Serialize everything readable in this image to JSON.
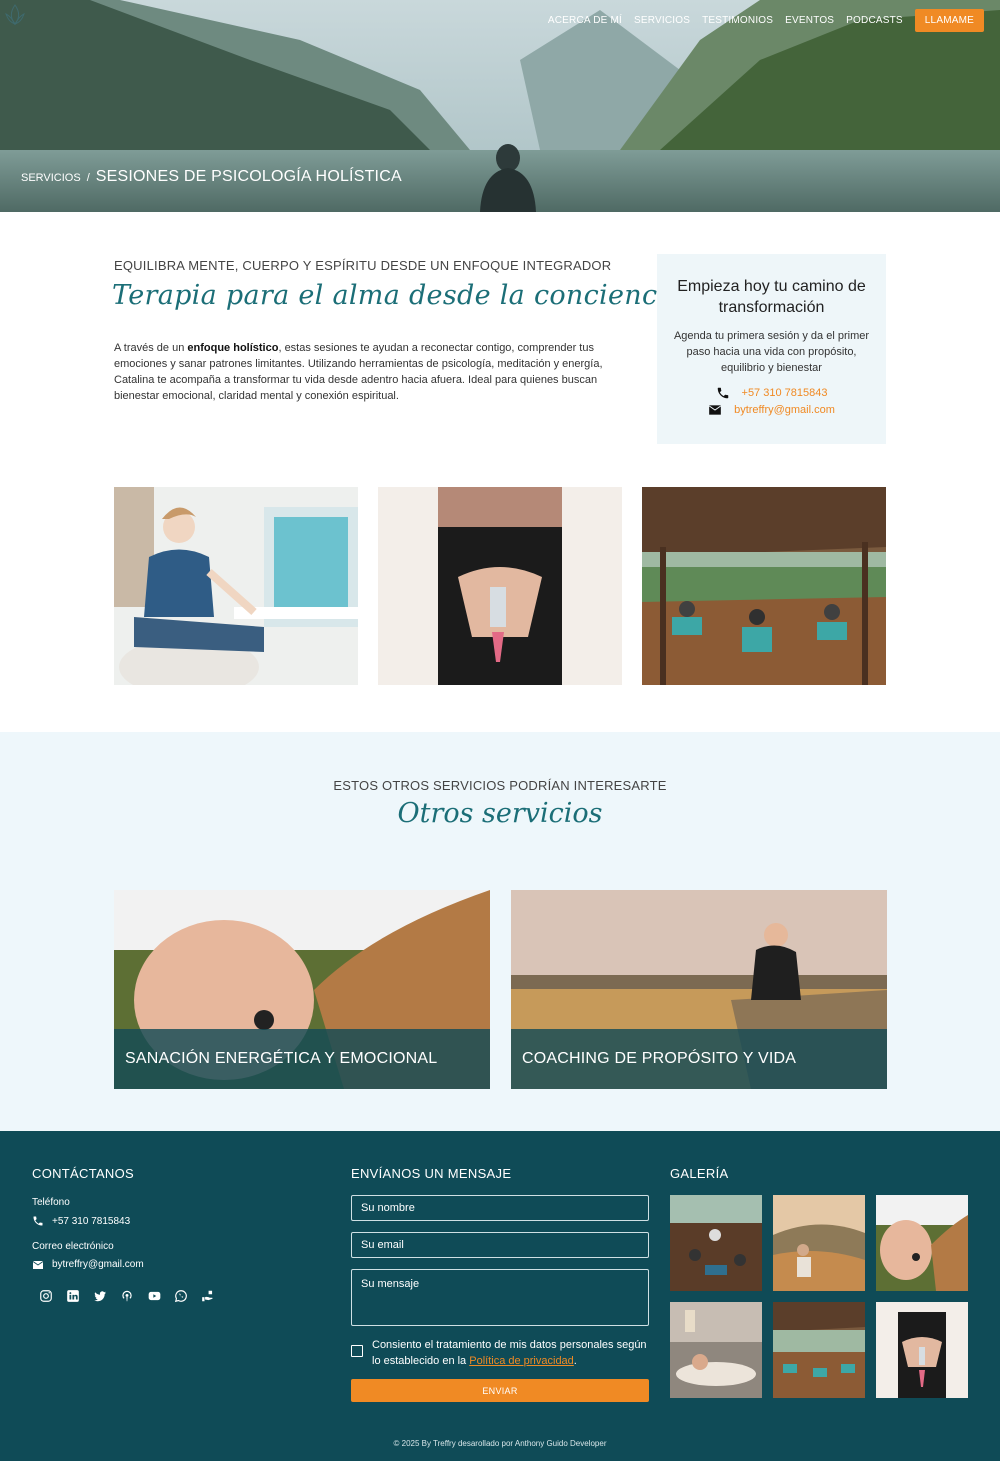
{
  "nav": {
    "items": [
      "ACERCA DE MÍ",
      "SERVICIOS",
      "TESTIMONIOS",
      "EVENTOS",
      "PODCASTS"
    ],
    "cta": "LLAMAME"
  },
  "breadcrumb": {
    "parent": "SERVICIOS",
    "separator": "/",
    "current": "SESIONES DE PSICOLOGÍA HOLÍSTICA"
  },
  "intro": {
    "eyebrow": "EQUILIBRA MENTE, CUERPO Y ESPÍRITU DESDE UN ENFOQUE INTEGRADOR",
    "script_title": "Terapia para el alma desde la conciencia",
    "text_before": "A través de un ",
    "text_bold": "enfoque holístico",
    "text_after": ", estas sesiones te ayudan a reconectar contigo, comprender tus emociones y sanar patrones limitantes. Utilizando herramientas de psicología, meditación y energía, Catalina te acompaña a transformar tu vida desde adentro hacia afuera. Ideal para quienes buscan bienestar emocional, claridad mental y conexión espiritual."
  },
  "cta_card": {
    "title": "Empieza hoy tu camino de transformación",
    "text": "Agenda tu primera sesión y da el primer paso hacia una vida con propósito, equilibrio y bienestar",
    "phone": "+57 310 7815843",
    "email": "bytreffry@gmail.com"
  },
  "others": {
    "eyebrow": "ESTOS OTROS SERVICIOS PODRÍAN INTERESARTE",
    "script_title": "Otros servicios",
    "cards": [
      {
        "title": "SANACIÓN ENERGÉTICA Y EMOCIONAL"
      },
      {
        "title": "COACHING DE PROPÓSITO Y VIDA"
      }
    ]
  },
  "footer": {
    "contact_heading": "CONTÁCTANOS",
    "phone_label": "Teléfono",
    "phone": "+57 310 7815843",
    "email_label": "Correo electrónico",
    "email": "bytreffry@gmail.com",
    "message_heading": "ENVÍANOS UN MENSAJE",
    "name_placeholder": "Su nombre",
    "email_placeholder": "Su email",
    "message_placeholder": "Su mensaje",
    "consent_text": "Consiento el tratamiento de mis datos personales según lo establecido en la ",
    "consent_link": "Política de privacidad",
    "consent_end": ".",
    "send": "ENVIAR",
    "gallery_heading": "GALERÍA",
    "copyright": "© 2025 By Treffry desarollado por Anthony Guido Developer"
  },
  "icons": [
    "logo-icon",
    "phone-icon",
    "mail-icon",
    "instagram-icon",
    "linkedin-icon",
    "twitter-icon",
    "podcast-icon",
    "youtube-icon",
    "whatsapp-icon",
    "donate-icon"
  ],
  "colors": {
    "accent": "#f08a24",
    "teal": "#1b6e77",
    "footer": "#0f4b57",
    "light": "#eef6f9"
  }
}
